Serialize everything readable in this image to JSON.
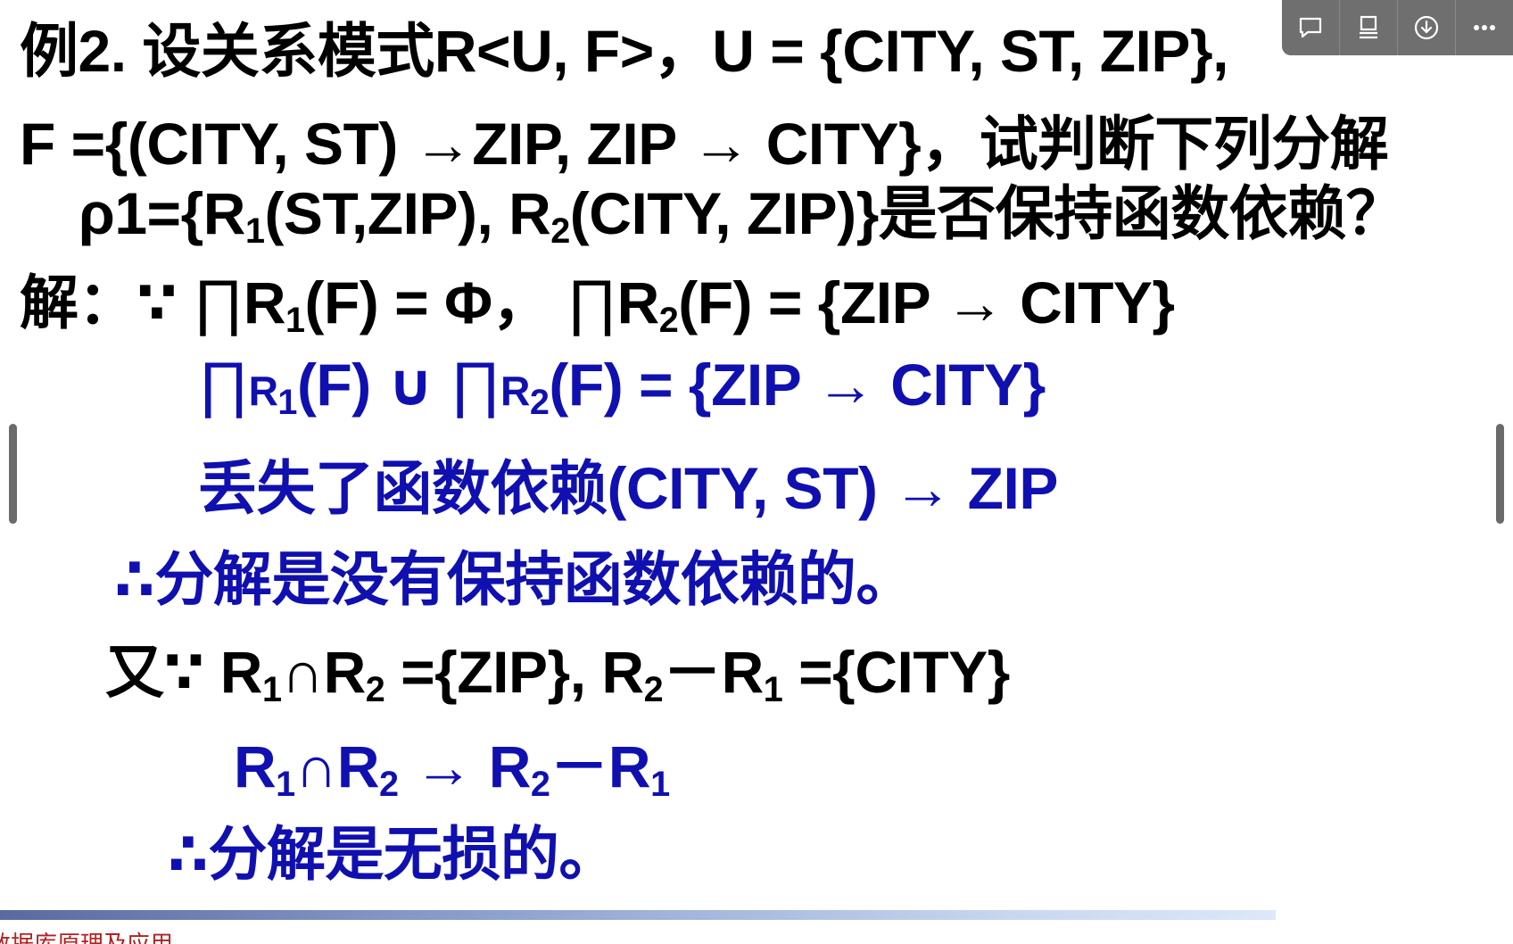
{
  "slide": {
    "line1": "例2. 设关系模式R<U, F>，U = {CITY, ST, ZIP},",
    "line2": "F ={(CITY, ST) →ZIP, ZIP → CITY}，试判断下列分解",
    "line3": {
      "pre": "ρ1={R",
      "sub1": "1",
      "mid": "(ST,ZIP), R",
      "sub2": "2",
      "post": "(CITY, ZIP)}是否保持函数依赖？"
    },
    "line4": {
      "lead": "解：∵ ",
      "prod1": "∏",
      "r1": "R",
      "sub1": "1",
      "mid": "(F) = Φ，  ",
      "prod2": "∏",
      "r2": "R",
      "sub2": "2",
      "post": "(F) = {ZIP → CITY}"
    },
    "line5": {
      "prod1": "∏",
      "r1": "R",
      "sub1": "1",
      "mid": "(F) ∪ ",
      "prod2": "∏",
      "r2": "R",
      "sub2": "2",
      "post": "(F) = {ZIP → CITY}"
    },
    "line6": "丢失了函数依赖(CITY, ST) → ZIP",
    "line7": "∴分解是没有保持函数依赖的。",
    "line8": {
      "lead": "又∵ R",
      "sub1": "1",
      "cap": "∩R",
      "sub2": "2",
      "mid": " ={ZIP}, R",
      "sub3": "2",
      "minus": "－R",
      "sub4": "1",
      "post": " ={CITY}"
    },
    "line9": {
      "r1": "R",
      "sub1": "1",
      "cap": "∩R",
      "sub2": "2",
      "arrow": " → R",
      "sub3": "2",
      "minus": "－R",
      "sub4": "1"
    },
    "line10": "∴分解是无损的。",
    "footer": "数据库原理及应用"
  },
  "toolbar": {
    "buttons": [
      {
        "icon": "comment-icon"
      },
      {
        "icon": "notes-icon"
      },
      {
        "icon": "download-icon"
      },
      {
        "icon": "more-icon"
      }
    ]
  },
  "colors": {
    "text": "#000000",
    "answer": "#1010b0",
    "toolbar": "#6f6f6f"
  }
}
